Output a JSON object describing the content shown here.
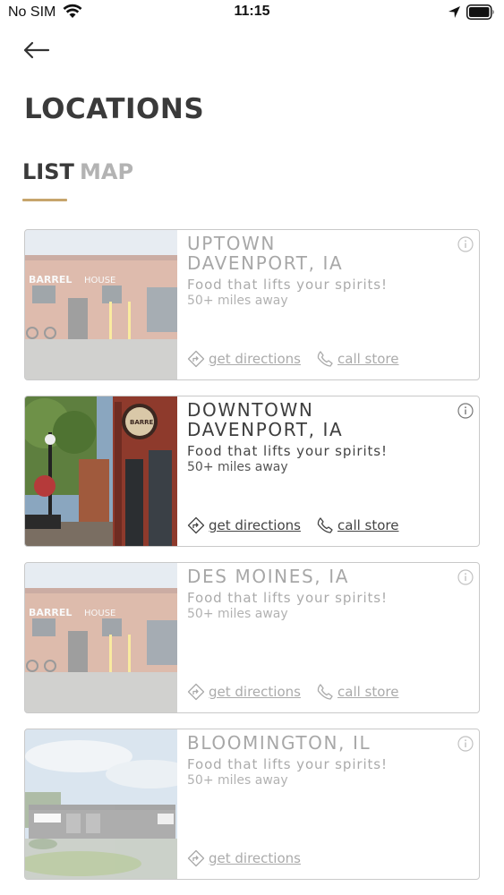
{
  "status": {
    "carrier": "No SIM",
    "time": "11:15"
  },
  "header": {
    "title": "LOCATIONS"
  },
  "tabs": [
    {
      "label": "LIST",
      "selected": true
    },
    {
      "label": "MAP",
      "selected": false
    }
  ],
  "locations": [
    {
      "name": "UPTOWN DAVENPORT, IA",
      "line1": "UPTOWN",
      "line2": "DAVENPORT, IA",
      "tagline": "Food that lifts your spirits!",
      "distance": "50+ miles away",
      "directions_label": "get directions",
      "call_label": "call store",
      "active": false,
      "photo": "brick-building-icon"
    },
    {
      "name": "DOWNTOWN DAVENPORT, IA",
      "line1": "DOWNTOWN",
      "line2": "DAVENPORT, IA",
      "tagline": "Food that lifts your spirits!",
      "distance": "50+ miles away",
      "directions_label": "get directions",
      "call_label": "call store",
      "active": true,
      "photo": "street-storefront-icon"
    },
    {
      "name": "DES MOINES, IA",
      "line1": "DES MOINES, IA",
      "tagline": "Food that lifts your spirits!",
      "distance": "50+ miles away",
      "directions_label": "get directions",
      "call_label": "call store",
      "active": false,
      "photo": "brick-building-icon"
    },
    {
      "name": "BLOOMINGTON, IL",
      "line1": "BLOOMINGTON, IL",
      "tagline": "Food that lifts your spirits!",
      "distance": "50+ miles away",
      "directions_label": "get directions",
      "active": false,
      "photo": "strip-mall-icon"
    }
  ],
  "photo_labels": {
    "sign_barrel": "BARREL",
    "sign_house": "HOUSE"
  },
  "colors": {
    "accent": "#c7a56c",
    "title": "#3a3a3a",
    "inactive_tab": "#b3b3b3",
    "card_border": "#c9c9c9"
  }
}
